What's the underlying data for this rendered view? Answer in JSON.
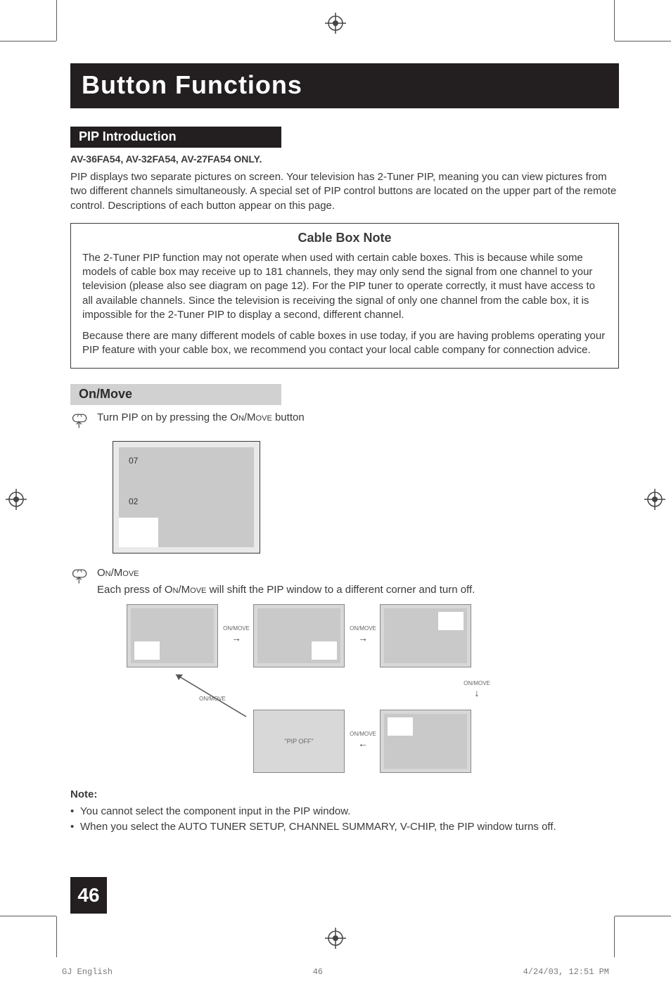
{
  "title": "Button Functions",
  "sections": {
    "pip_intro": {
      "heading": "PIP Introduction",
      "models_line": "AV-36FA54, AV-32FA54, AV-27FA54 ONLY.",
      "body": "PIP displays two separate pictures on screen.  Your television has 2-Tuner PIP, meaning you can view pictures from two different channels simultaneously.  A special set of PIP control buttons are located on the upper part of the remote control.  Descriptions of each button appear on this page."
    },
    "cable_box": {
      "heading": "Cable Box Note",
      "para1": "The 2-Tuner PIP function may not operate when used with certain cable boxes.  This is because while some models of cable box may receive up to 181 channels, they may only send the signal from one channel to your television (please also see diagram on page 12).  For the PIP tuner to operate correctly, it must have access to all available channels.  Since the television is receiving the signal of only one channel from the cable box, it is impossible for the 2-Tuner PIP to display a second, different channel.",
      "para2": "Because there are many different models of cable boxes in use today, if you are having problems operating your PIP feature with your cable box, we recommend you contact your local cable company for connection advice."
    },
    "on_move": {
      "heading": "On/Move",
      "line1_prefix": "Turn PIP on by pressing the ",
      "btn_label": "On/Move",
      "line1_suffix": " button",
      "tv": {
        "ch1": "07",
        "ch2": "02"
      },
      "line2_heading": "On/Move",
      "line2_prefix": "Each press of ",
      "line2_suffix": " will shift the PIP window to a different corner and turn off.",
      "cycle_labels": {
        "arrow": "ON/MOVE",
        "off_text": "\"PIP OFF\""
      }
    },
    "notes": {
      "heading": "Note:",
      "items": [
        "You cannot select the component input in the PIP window.",
        "When you select the AUTO TUNER SETUP, CHANNEL SUMMARY, V-CHIP, the PIP window turns off."
      ]
    }
  },
  "page_number": "46",
  "footer": {
    "left": "GJ English",
    "mid": "46",
    "right": "4/24/03, 12:51 PM"
  }
}
